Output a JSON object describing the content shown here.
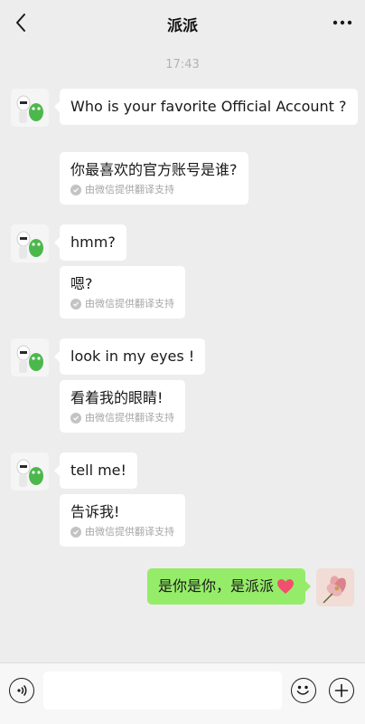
{
  "header": {
    "title": "派派",
    "back_icon": "chevron-left-icon",
    "more_icon": "more-dots-icon"
  },
  "chat": {
    "timestamp": "17:43",
    "messages": [
      {
        "original": "Who is your favorite Official Account ?",
        "translation": "你最喜欢的官方账号是谁?",
        "note": "由微信提供翻译支持"
      },
      {
        "original": "hmm?",
        "translation": "嗯?",
        "note": "由微信提供翻译支持"
      },
      {
        "original": "look in my eyes !",
        "translation": "看着我的眼睛!",
        "note": "由微信提供翻译支持"
      },
      {
        "original": "tell me!",
        "translation": "告诉我!",
        "note": "由微信提供翻译支持"
      }
    ],
    "my_message": "是你是你，是派派"
  },
  "bottom_bar": {
    "input_value": "",
    "voice_icon": "voice-icon",
    "emoji_icon": "emoji-icon",
    "plus_icon": "plus-icon"
  },
  "colors": {
    "background": "#ededed",
    "my_bubble": "#95ec69",
    "other_bubble": "#ffffff",
    "heart": "#f0506e"
  }
}
